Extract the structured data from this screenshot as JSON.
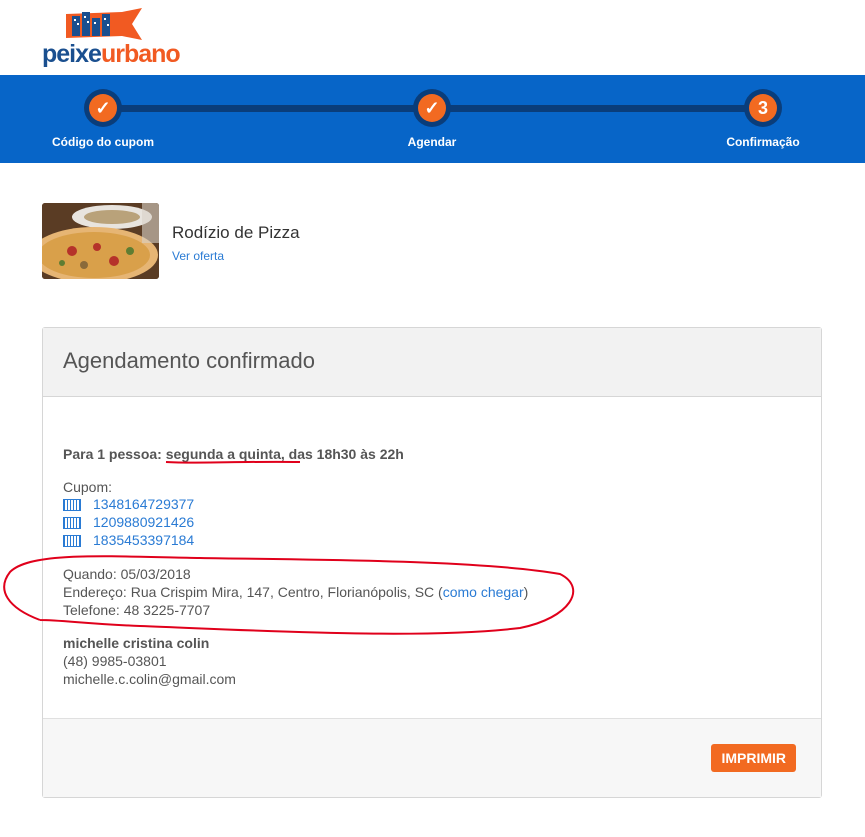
{
  "brand": {
    "part1": "peixe",
    "part2": "urbano"
  },
  "stepper": [
    {
      "icon": "check-icon",
      "label": "Código do cupom"
    },
    {
      "icon": "check-icon",
      "label": "Agendar"
    },
    {
      "number": "3",
      "label": "Confirmação"
    }
  ],
  "offer": {
    "title": "Rodízio de Pizza",
    "link": "Ver oferta"
  },
  "panel": {
    "title": "Agendamento confirmado",
    "people_label": "Para 1 pessoa:",
    "schedule": "segunda a quinta, das 18h30 às 22h",
    "coupon_label": "Cupom:",
    "coupons": [
      "1348164729377",
      "1209880921426",
      "1835453397184"
    ],
    "when": "Quando: 05/03/2018",
    "address_prefix": "Endereço: Rua Crispim Mira, 147, Centro, Florianópolis, SC (",
    "directions_link": "como chegar",
    "address_suffix": ")",
    "phone": "Telefone: 48 3225-7707",
    "customer_name": "michelle cristina colin",
    "customer_phone": "(48) 9985-03801",
    "customer_email": "michelle.c.colin@gmail.com",
    "print_button": "IMPRIMIR"
  },
  "colors": {
    "accent": "#f26a21",
    "stepper_bg": "#0765c8",
    "link": "#2a7bd4",
    "annotation": "#e0001b"
  }
}
